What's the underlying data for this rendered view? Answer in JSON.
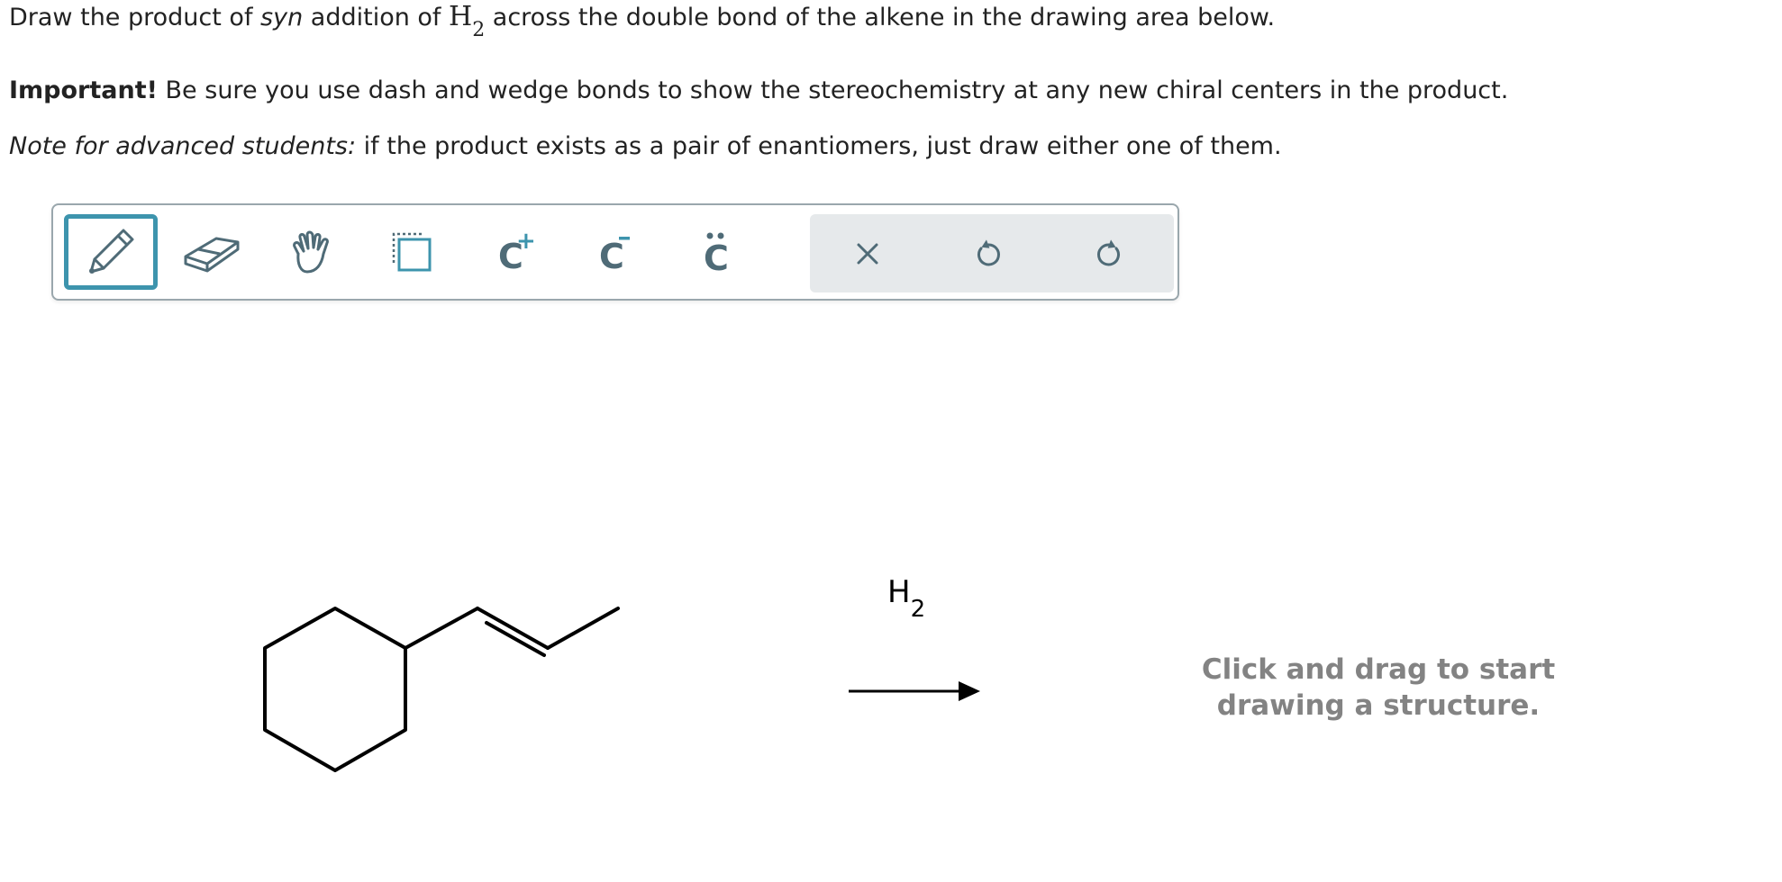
{
  "question": {
    "line1": {
      "part1": "Draw the product of ",
      "syn": "syn",
      "part2": " addition of ",
      "reagent_h": "H",
      "reagent_sub": "2",
      "part3": " across the double bond of the alkene in the drawing area below."
    },
    "line2": {
      "important": "Important!",
      "rest": " Be sure you use dash and wedge bonds to show the stereochemistry at any new chiral centers in the product."
    },
    "line3": {
      "note": "Note for advanced students:",
      "rest": " if the product exists as a pair of enantiomers, just draw either one of them."
    }
  },
  "toolbar": {
    "tools": [
      {
        "name": "pencil-icon",
        "selected": true
      },
      {
        "name": "eraser-icon"
      },
      {
        "name": "hand-icon"
      },
      {
        "name": "select-icon"
      },
      {
        "name": "carbocation-icon",
        "label": "C",
        "superscript": "+"
      },
      {
        "name": "carbanion-icon",
        "label": "C",
        "superscript": "−"
      },
      {
        "name": "carbene-icon",
        "label": "C",
        "superscript": "••"
      }
    ],
    "actions": [
      {
        "name": "clear-icon",
        "glyph": "×"
      },
      {
        "name": "undo-icon"
      },
      {
        "name": "redo-icon"
      }
    ],
    "accent_color": "#3d94ad",
    "icon_color": "#4f6b77"
  },
  "reaction": {
    "reagent_h": "H",
    "reagent_sub": "2"
  },
  "canvas": {
    "hint_line1": "Click and drag to start",
    "hint_line2": "drawing a structure."
  }
}
